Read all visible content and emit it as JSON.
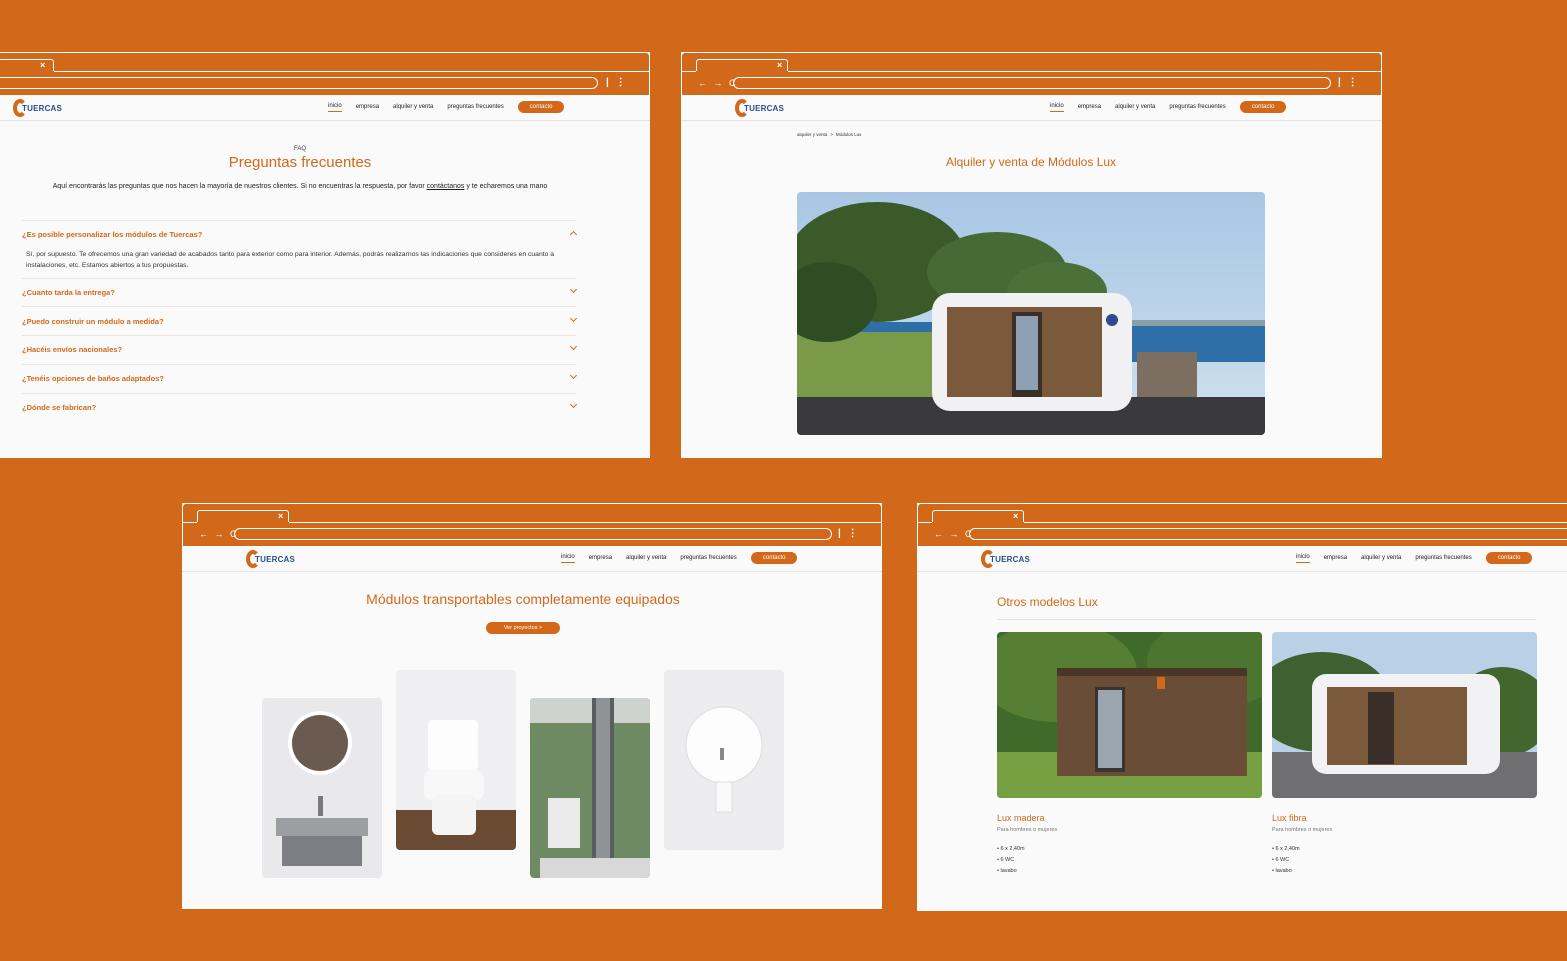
{
  "browser": {
    "tab_close": "×",
    "nav_arrows": "← → C",
    "menu": "| ⋮"
  },
  "site": {
    "logo_text": "TUERCAS",
    "nav": {
      "inicio": "inicio",
      "empresa": "empresa",
      "alquiler": "alquiler y venta",
      "preguntas": "preguntas frecuentes",
      "contacto": "contacto"
    }
  },
  "faq_page": {
    "eyebrow": "FAQ",
    "title": "Preguntas frecuentes",
    "intro_1": "Aquí encontrarás las preguntas que nos hacen la mayoría de  nuestros clientes. Si no encuentras la respuesta, por favor ",
    "intro_link": "contáctanos",
    "intro_2": " y te echaremos una mano",
    "items": [
      {
        "q": "¿Es posible personalizar los módulos de Tuercas?",
        "a": "Sí, por supuesto. Te ofrecemos una gran variedad de acabados tanto para exterior como para interior. Además, podrás realizarnos las indicaciones que consideres en cuanto a instalaciones, etc. Estamos abiertos a tus propuestas."
      },
      {
        "q": "¿Cuanto tarda la entrega?"
      },
      {
        "q": "¿Puedo construir un módulo a medida?"
      },
      {
        "q": "¿Hacéis envíos nacionales?"
      },
      {
        "q": "¿Tenéis opciones de baños adaptados?"
      },
      {
        "q": "¿Dónde se fabrican?"
      }
    ]
  },
  "lux_page": {
    "breadcrumb_1": "alquiler y venta",
    "breadcrumb_sep": ">",
    "breadcrumb_2": "Módulos Lux",
    "title": "Alquiler y venta de Módulos Lux"
  },
  "equip_page": {
    "title": "Módulos transportables completamente equipados",
    "button": "Ver proyectos >"
  },
  "models_page": {
    "title": "Otros modelos Lux",
    "models": [
      {
        "name": "Lux madera",
        "subtitle": "Para hombres o mujeres",
        "features": [
          "6 x 2,40m",
          "6 WC",
          "lavabo"
        ]
      },
      {
        "name": "Lux fibra",
        "subtitle": "Para hombres o mujeres",
        "features": [
          "6 x 2,40m",
          "6 WC",
          "lavabo"
        ]
      }
    ]
  },
  "colors": {
    "brand_orange": "#D2691A",
    "logo_blue": "#2a4c8f",
    "page_bg": "#fafafa"
  }
}
